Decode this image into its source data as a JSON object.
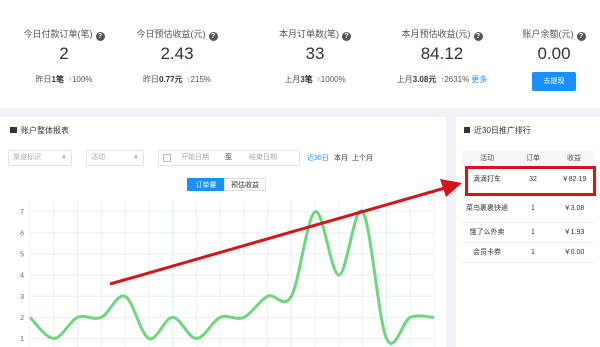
{
  "stats": [
    {
      "title": "今日付款订单(笔)",
      "value": "2",
      "sub_prefix": "昨日",
      "sub_value": "1笔",
      "sub_change": "100%",
      "more": ""
    },
    {
      "title": "今日预估收益(元)",
      "value": "2.43",
      "sub_prefix": "昨日",
      "sub_value": "0.77元",
      "sub_change": "215%",
      "more": ""
    },
    {
      "title": "本月订单数(笔)",
      "value": "33",
      "sub_prefix": "上月",
      "sub_value": "3笔",
      "sub_change": "1000%",
      "more": ""
    },
    {
      "title": "本月预估收益(元)",
      "value": "84.12",
      "sub_prefix": "上月",
      "sub_value": "3.08元",
      "sub_change": "2631%",
      "more": "更多"
    },
    {
      "title": "账户余额(元)",
      "value": "0.00"
    }
  ],
  "withdraw_label": "去提现",
  "report": {
    "title": "账户整体报表",
    "filter_source": "渠道标识",
    "filter_activity": "活动",
    "date_start": "开始日期",
    "date_sep": "至",
    "date_end": "结束日期",
    "quick_30": "近30日",
    "quick_month": "本月",
    "quick_last_month": "上个月",
    "tab_orders": "订单量",
    "tab_income": "预估收益"
  },
  "ranking": {
    "title": "近30日推广排行",
    "headers": [
      "活动",
      "订单",
      "收益"
    ],
    "rows": [
      [
        "滴滴打车",
        "32",
        "￥82.19"
      ],
      [
        "菜鸟裹裹快递",
        "1",
        "￥3.08"
      ],
      [
        "饿了么外卖",
        "1",
        "￥1.93"
      ],
      [
        "会员卡券",
        "1",
        "￥0.00"
      ]
    ]
  },
  "colors": {
    "accent": "#1890ff",
    "line": "#6fd67f",
    "annotation": "#d8141b"
  },
  "chart_data": {
    "type": "line",
    "y_ticks": [
      "7",
      "6",
      "5",
      "4",
      "3",
      "2",
      "1"
    ],
    "ylim": [
      0.6,
      7.6
    ],
    "grid": true,
    "series": [
      {
        "values": [
          2,
          1,
          2,
          2,
          3,
          1,
          2,
          1,
          2,
          2,
          3,
          3,
          7,
          4,
          7,
          1,
          2,
          2
        ]
      }
    ]
  }
}
